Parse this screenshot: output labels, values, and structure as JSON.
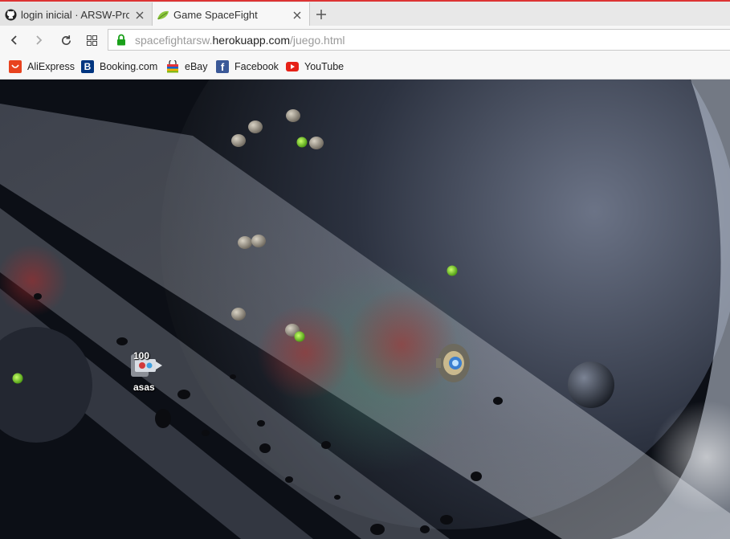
{
  "tabs": [
    {
      "title": "login inicial · ARSW-Proyec",
      "icon": "github-icon",
      "active": false
    },
    {
      "title": "Game SpaceFight",
      "icon": "leaf-icon",
      "active": true
    }
  ],
  "address_bar": {
    "url_faded_prefix": "spacefightarsw.",
    "url_domain": "herokuapp.com",
    "url_path": "/juego.html",
    "secure": true
  },
  "bookmarks": [
    {
      "label": "AliExpress",
      "icon": "aliexpress-icon"
    },
    {
      "label": "Booking.com",
      "icon": "booking-icon"
    },
    {
      "label": "eBay",
      "icon": "ebay-icon"
    },
    {
      "label": "Facebook",
      "icon": "facebook-icon"
    },
    {
      "label": "YouTube",
      "icon": "youtube-icon"
    }
  ],
  "game": {
    "player": {
      "name": "asas",
      "health": "100"
    },
    "colors": {
      "accent_tab_border": "#d33333",
      "powerup": "#7bdc2c",
      "lock_green": "#1aa01a"
    }
  }
}
